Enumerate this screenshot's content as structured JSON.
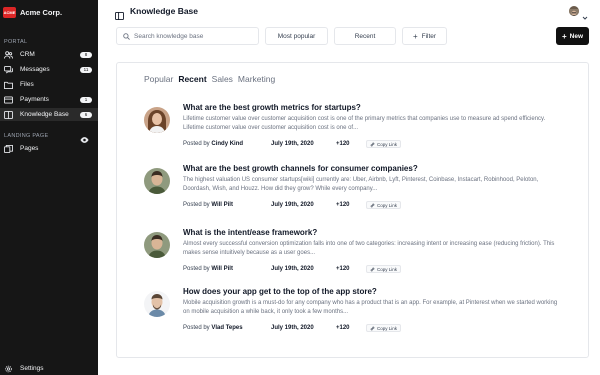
{
  "sidebar": {
    "brand": {
      "logo_text": "ACME",
      "name": "Acme Corp."
    },
    "sections": [
      {
        "label": "PORTAL"
      },
      {
        "label": "LANDING PAGE"
      }
    ],
    "items": [
      {
        "label": "CRM",
        "badge": "8",
        "icon": "users-icon"
      },
      {
        "label": "Messages",
        "badge": "11",
        "icon": "messages-icon"
      },
      {
        "label": "Files",
        "badge": "",
        "icon": "files-icon"
      },
      {
        "label": "Payments",
        "badge": "1",
        "icon": "payments-icon"
      },
      {
        "label": "Knowledge Base",
        "badge": "6",
        "icon": "book-icon",
        "active": true
      },
      {
        "label": "Pages",
        "badge": "",
        "icon": "pages-icon"
      }
    ],
    "settings": {
      "label": "Settings",
      "icon": "gear-icon"
    }
  },
  "header": {
    "title": "Knowledge Base"
  },
  "toolbar": {
    "search_placeholder": "Search knowledge base",
    "most_popular": "Most popular",
    "recent": "Recent",
    "filter": "Filter",
    "new": "New"
  },
  "tabs": [
    "Popular",
    "Recent",
    "Sales",
    "Marketing"
  ],
  "articles": [
    {
      "title": "What are the best growth metrics for startups?",
      "excerpt": "Lifetime customer value over customer acquisition cost is one of the primary metrics that companies use to measure ad spend efficiency. Lifetime customer value over customer acquisition cost is one of...",
      "posted_by_prefix": "Posted by",
      "author": "Cindy Kind",
      "date": "July 19th, 2020",
      "count": "+120",
      "copy_label": "Copy Link"
    },
    {
      "title": "What are the best growth channels for consumer companies?",
      "excerpt": "The highest valuation US consumer startups[wiki] currently are: Uber, Airbnb, Lyft, Pinterest, Coinbase, Instacart, Robinhood, Peloton, Doordash, Wish, and Houzz. How did they grow? While every company...",
      "posted_by_prefix": "Posted by",
      "author": "Will Pilt",
      "date": "July 19th, 2020",
      "count": "+120",
      "copy_label": "Copy Link"
    },
    {
      "title": "What is the intent/ease framework?",
      "excerpt": "Almost every successful conversion optimization falls into one of two categories: increasing intent or increasing ease (reducing friction). This makes sense intuitively because as a user goes...",
      "posted_by_prefix": "Posted by",
      "author": "Will Pilt",
      "date": "July 19th, 2020",
      "count": "+120",
      "copy_label": "Copy Link"
    },
    {
      "title": "How does your app get to the top of the app store?",
      "excerpt": "Mobile acquisition growth is a must-do for any company who has a product that is an app. For example, at Pinterest when we started working on mobile acquisition a while back, it only took a few months...",
      "posted_by_prefix": "Posted by",
      "author": "Vlad Tepes",
      "date": "July 19th, 2020",
      "count": "+120",
      "copy_label": "Copy Link"
    }
  ]
}
